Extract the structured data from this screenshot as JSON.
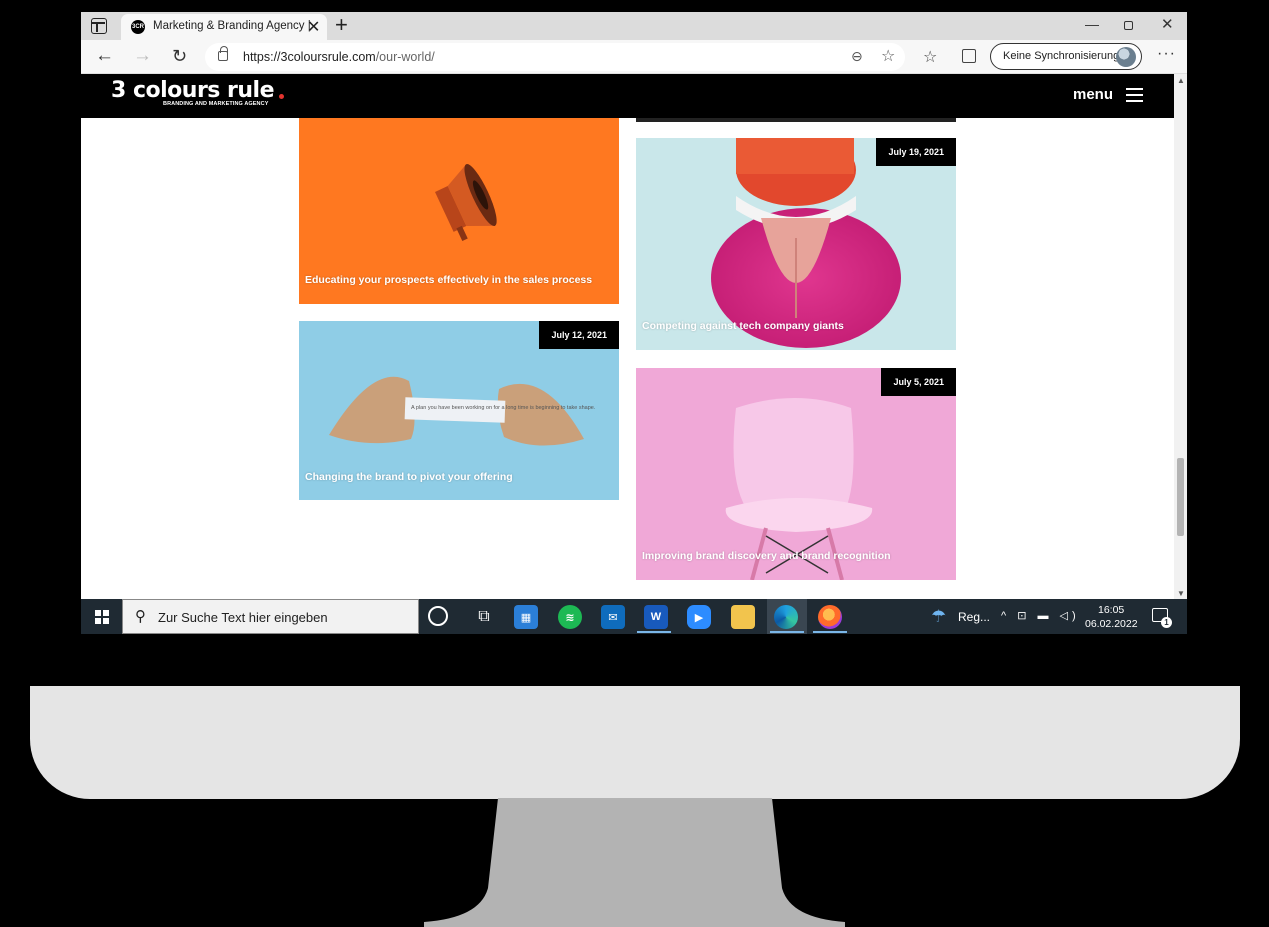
{
  "browser": {
    "tab_title": "Marketing & Branding Agency |",
    "tab_favicon_text": "3CR",
    "url_domain": "https://3coloursrule.com",
    "url_path": "/our-world/",
    "sync_label": "Keine Synchronisierung"
  },
  "site": {
    "logo_text": "3 colours rule",
    "logo_tagline": "BRANDING AND MARKETING AGENCY",
    "menu_label": "menu",
    "cards": [
      {
        "title": "Educating your prospects effectively in the sales process",
        "date": ""
      },
      {
        "title": "Competing against tech company giants",
        "date": "July 19, 2021"
      },
      {
        "title": "Changing the brand to pivot your offering",
        "date": "July 12, 2021"
      },
      {
        "title": "Improving brand discovery and brand recognition",
        "date": "July 5, 2021"
      }
    ],
    "fortune_paper_text": "A plan you have been working on for a long time is beginning to take shape."
  },
  "taskbar": {
    "search_placeholder": "Zur Suche Text hier eingeben",
    "weather_text": "Reg...",
    "time": "16:05",
    "date": "06.02.2022",
    "notification_count": "1"
  },
  "colors": {
    "card_orange": "#ff7820",
    "card_blue": "#8fcde6",
    "card_pink": "#f0a8d7",
    "header_black": "#000000",
    "taskbar_bg": "#1f2a33"
  }
}
